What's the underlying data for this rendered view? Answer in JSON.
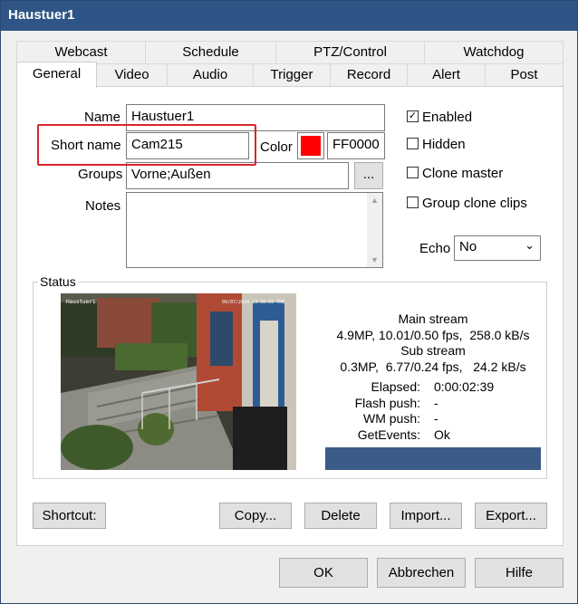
{
  "window": {
    "title": "Haustuer1"
  },
  "tabs_row1": [
    {
      "label": "Webcast"
    },
    {
      "label": "Schedule"
    },
    {
      "label": "PTZ/Control"
    },
    {
      "label": "Watchdog"
    }
  ],
  "tabs_row2": [
    {
      "label": "General"
    },
    {
      "label": "Video"
    },
    {
      "label": "Audio"
    },
    {
      "label": "Trigger"
    },
    {
      "label": "Record"
    },
    {
      "label": "Alert"
    },
    {
      "label": "Post"
    }
  ],
  "form": {
    "name_label": "Name",
    "name_value": "Haustuer1",
    "short_name_label": "Short name",
    "short_name_value": "Cam215",
    "color_label": "Color",
    "color_value": "FF0000",
    "color_swatch": "#ff0000",
    "groups_label": "Groups",
    "groups_value": "Vorne;Außen",
    "groups_button": "...",
    "notes_label": "Notes",
    "notes_value": ""
  },
  "checkboxes": [
    {
      "label": "Enabled",
      "checked": true
    },
    {
      "label": "Hidden",
      "checked": false
    },
    {
      "label": "Clone master",
      "checked": false
    },
    {
      "label": "Group clone clips",
      "checked": false
    }
  ],
  "echo": {
    "label": "Echo",
    "value": "No"
  },
  "status": {
    "label": "Status",
    "camera_overlay_name": "Haustuer1",
    "camera_overlay_time": "09/07/2024 13:30:55 THE",
    "main_stream_title": "Main stream",
    "main_stream_info": "4.9MP, 10.01/0.50 fps,  258.0 kB/s",
    "sub_stream_title": "Sub stream",
    "sub_stream_info": "0.3MP,  6.77/0.24 fps,   24.2 kB/s",
    "elapsed_label": "Elapsed:",
    "elapsed_value": "0:00:02:39",
    "flash_label": "Flash push:",
    "flash_value": "-",
    "wm_label": "WM push:",
    "wm_value": "-",
    "getevents_label": "GetEvents:",
    "getevents_value": "Ok",
    "bar_color": "#3b5b88"
  },
  "panel_buttons": {
    "shortcut": "Shortcut:",
    "copy": "Copy...",
    "delete": "Delete",
    "import": "Import...",
    "export": "Export..."
  },
  "dialog_buttons": {
    "ok": "OK",
    "cancel": "Abbrechen",
    "help": "Hilfe"
  },
  "colors": {
    "titlebar": "#2f5586",
    "highlight": "#d9262b"
  }
}
